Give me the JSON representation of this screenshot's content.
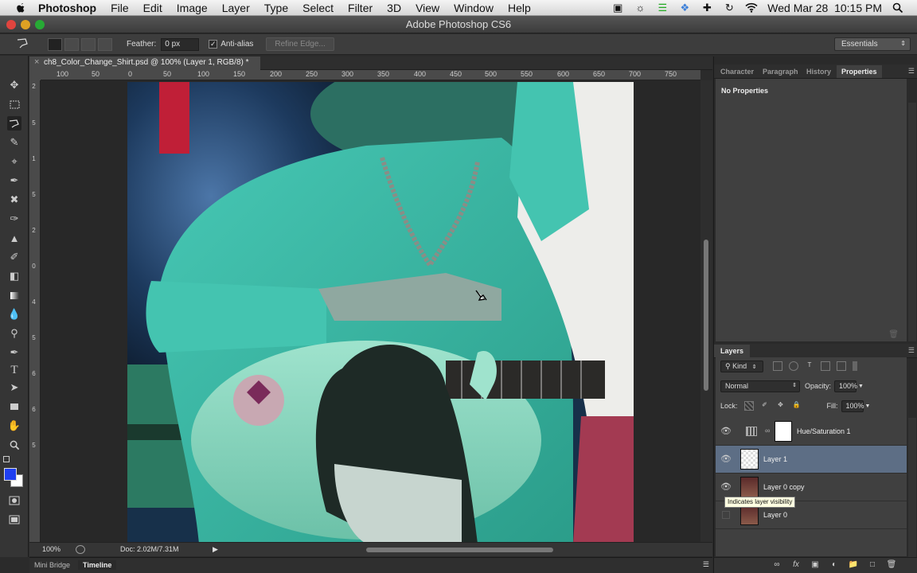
{
  "menubar": {
    "apple_icon": "apple-logo-icon",
    "items": [
      "Photoshop",
      "File",
      "Edit",
      "Image",
      "Layer",
      "Type",
      "Select",
      "Filter",
      "3D",
      "View",
      "Window",
      "Help"
    ],
    "clock": "Wed Mar 28  10:15 PM",
    "status_icons": [
      "camera-icon",
      "brightness-icon",
      "battery-bars-icon",
      "dropbox-icon",
      "plus-cross-icon",
      "sync-icon",
      "wifi-icon",
      "search-icon"
    ]
  },
  "window": {
    "title": "Adobe Photoshop CS6"
  },
  "options_bar": {
    "tool_icon": "polygonal-lasso-icon",
    "feather_label": "Feather:",
    "feather_value": "0 px",
    "antialias_label": "Anti-alias",
    "antialias_checked": true,
    "refine_edge_label": "Refine Edge...",
    "workspace_value": "Essentials"
  },
  "tools": [
    "move-tool-icon",
    "marquee-tool-icon",
    "lasso-tool-icon",
    "quick-selection-tool-icon",
    "crop-tool-icon",
    "eyedropper-tool-icon",
    "healing-brush-tool-icon",
    "brush-tool-icon",
    "clone-stamp-tool-icon",
    "history-brush-tool-icon",
    "eraser-tool-icon",
    "gradient-tool-icon",
    "blur-tool-icon",
    "dodge-tool-icon",
    "pen-tool-icon",
    "type-tool-icon",
    "path-selection-tool-icon",
    "rectangle-tool-icon",
    "hand-tool-icon",
    "zoom-tool-icon"
  ],
  "colors": {
    "foreground": "#1f3ff0",
    "background": "#ffffff",
    "selected_layer": "#5d6e85"
  },
  "document": {
    "tab_title": "ch8_Color_Change_Shirt.psd @ 100% (Layer 1, RGB/8) *",
    "zoom": "100%",
    "doc_size": "Doc: 2.02M/7.31M"
  },
  "rulers": {
    "horizontal": [
      "100",
      "50",
      "0",
      "50",
      "100",
      "150",
      "200",
      "250",
      "300",
      "350",
      "400",
      "450",
      "500",
      "550",
      "600",
      "650",
      "700",
      "750"
    ],
    "vertical": [
      "2",
      "5",
      "1",
      "5",
      "2",
      "0",
      "4",
      "5",
      "6",
      "6",
      "5"
    ]
  },
  "bottom_tabs": [
    "Mini Bridge",
    "Timeline"
  ],
  "top_panel": {
    "tabs": [
      "Character",
      "Paragraph",
      "History",
      "Properties"
    ],
    "active_tab": "Properties",
    "body_text": "No Properties"
  },
  "layers_panel": {
    "tab": "Layers",
    "filter_label": "Kind",
    "blend_mode": "Normal",
    "opacity_label": "Opacity:",
    "opacity_value": "100%",
    "lock_label": "Lock:",
    "fill_label": "Fill:",
    "fill_value": "100%",
    "layers": [
      {
        "name": "Hue/Saturation 1",
        "visible": true,
        "selected": false
      },
      {
        "name": "Layer 1",
        "visible": true,
        "selected": true
      },
      {
        "name": "Layer 0 copy",
        "visible": true,
        "selected": false
      },
      {
        "name": "Layer 0",
        "visible": false,
        "selected": false
      }
    ],
    "tooltip": "Indicates layer visibility"
  }
}
